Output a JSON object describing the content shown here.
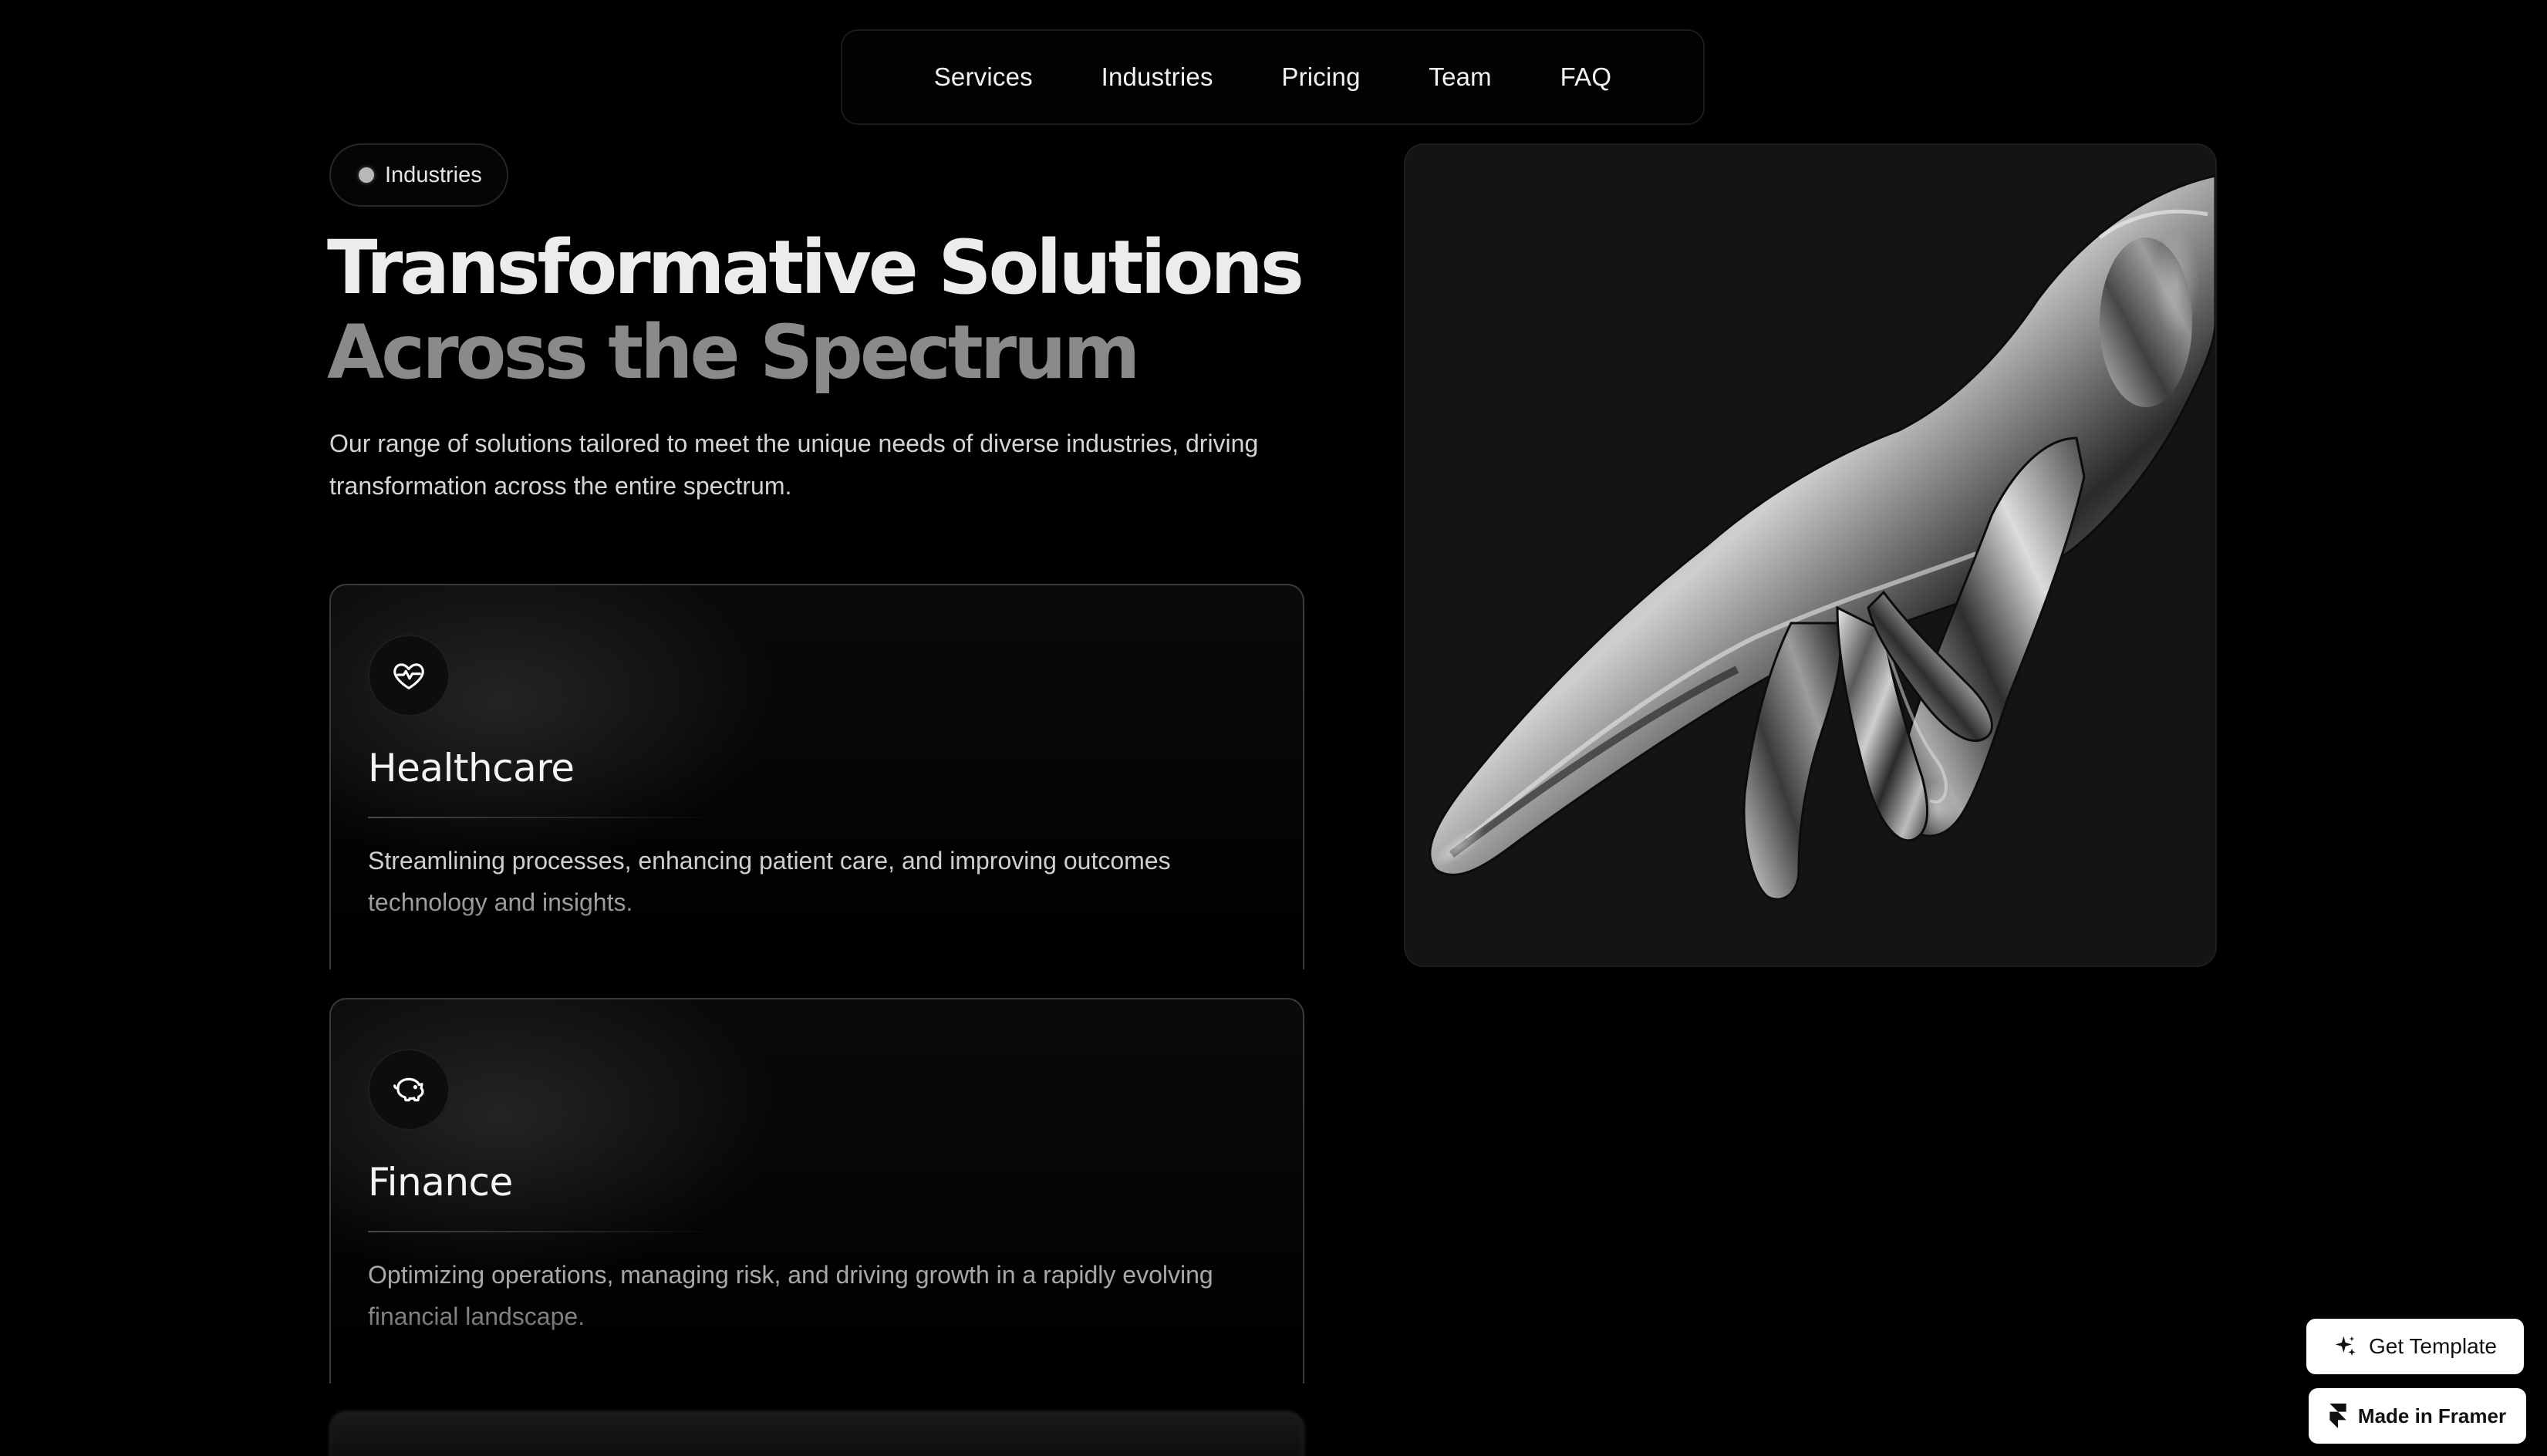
{
  "nav": {
    "items": [
      {
        "label": "Services"
      },
      {
        "label": "Industries"
      },
      {
        "label": "Pricing"
      },
      {
        "label": "Team"
      },
      {
        "label": "FAQ"
      }
    ]
  },
  "section": {
    "badge": "Industries",
    "title_line1": "Transformative Solutions",
    "title_line2": "Across the Spectrum",
    "lead": "Our range of solutions tailored to meet the unique needs of diverse industries, driving transformation across the entire spectrum."
  },
  "cards": [
    {
      "icon": "heart-pulse-icon",
      "title": "Healthcare",
      "description": "Streamlining processes, enhancing patient care, and improving outcomes technology and insights."
    },
    {
      "icon": "piggy-bank-icon",
      "title": "Finance",
      "description": "Optimizing operations, managing risk, and driving growth in a rapidly evolving financial landscape."
    }
  ],
  "floating": {
    "get_template": "Get Template",
    "made_in_framer": "Made in Framer"
  },
  "colors": {
    "background": "#000000",
    "text_primary": "#ececec",
    "text_muted": "#8a8a8a",
    "button_bg": "#ffffff"
  }
}
